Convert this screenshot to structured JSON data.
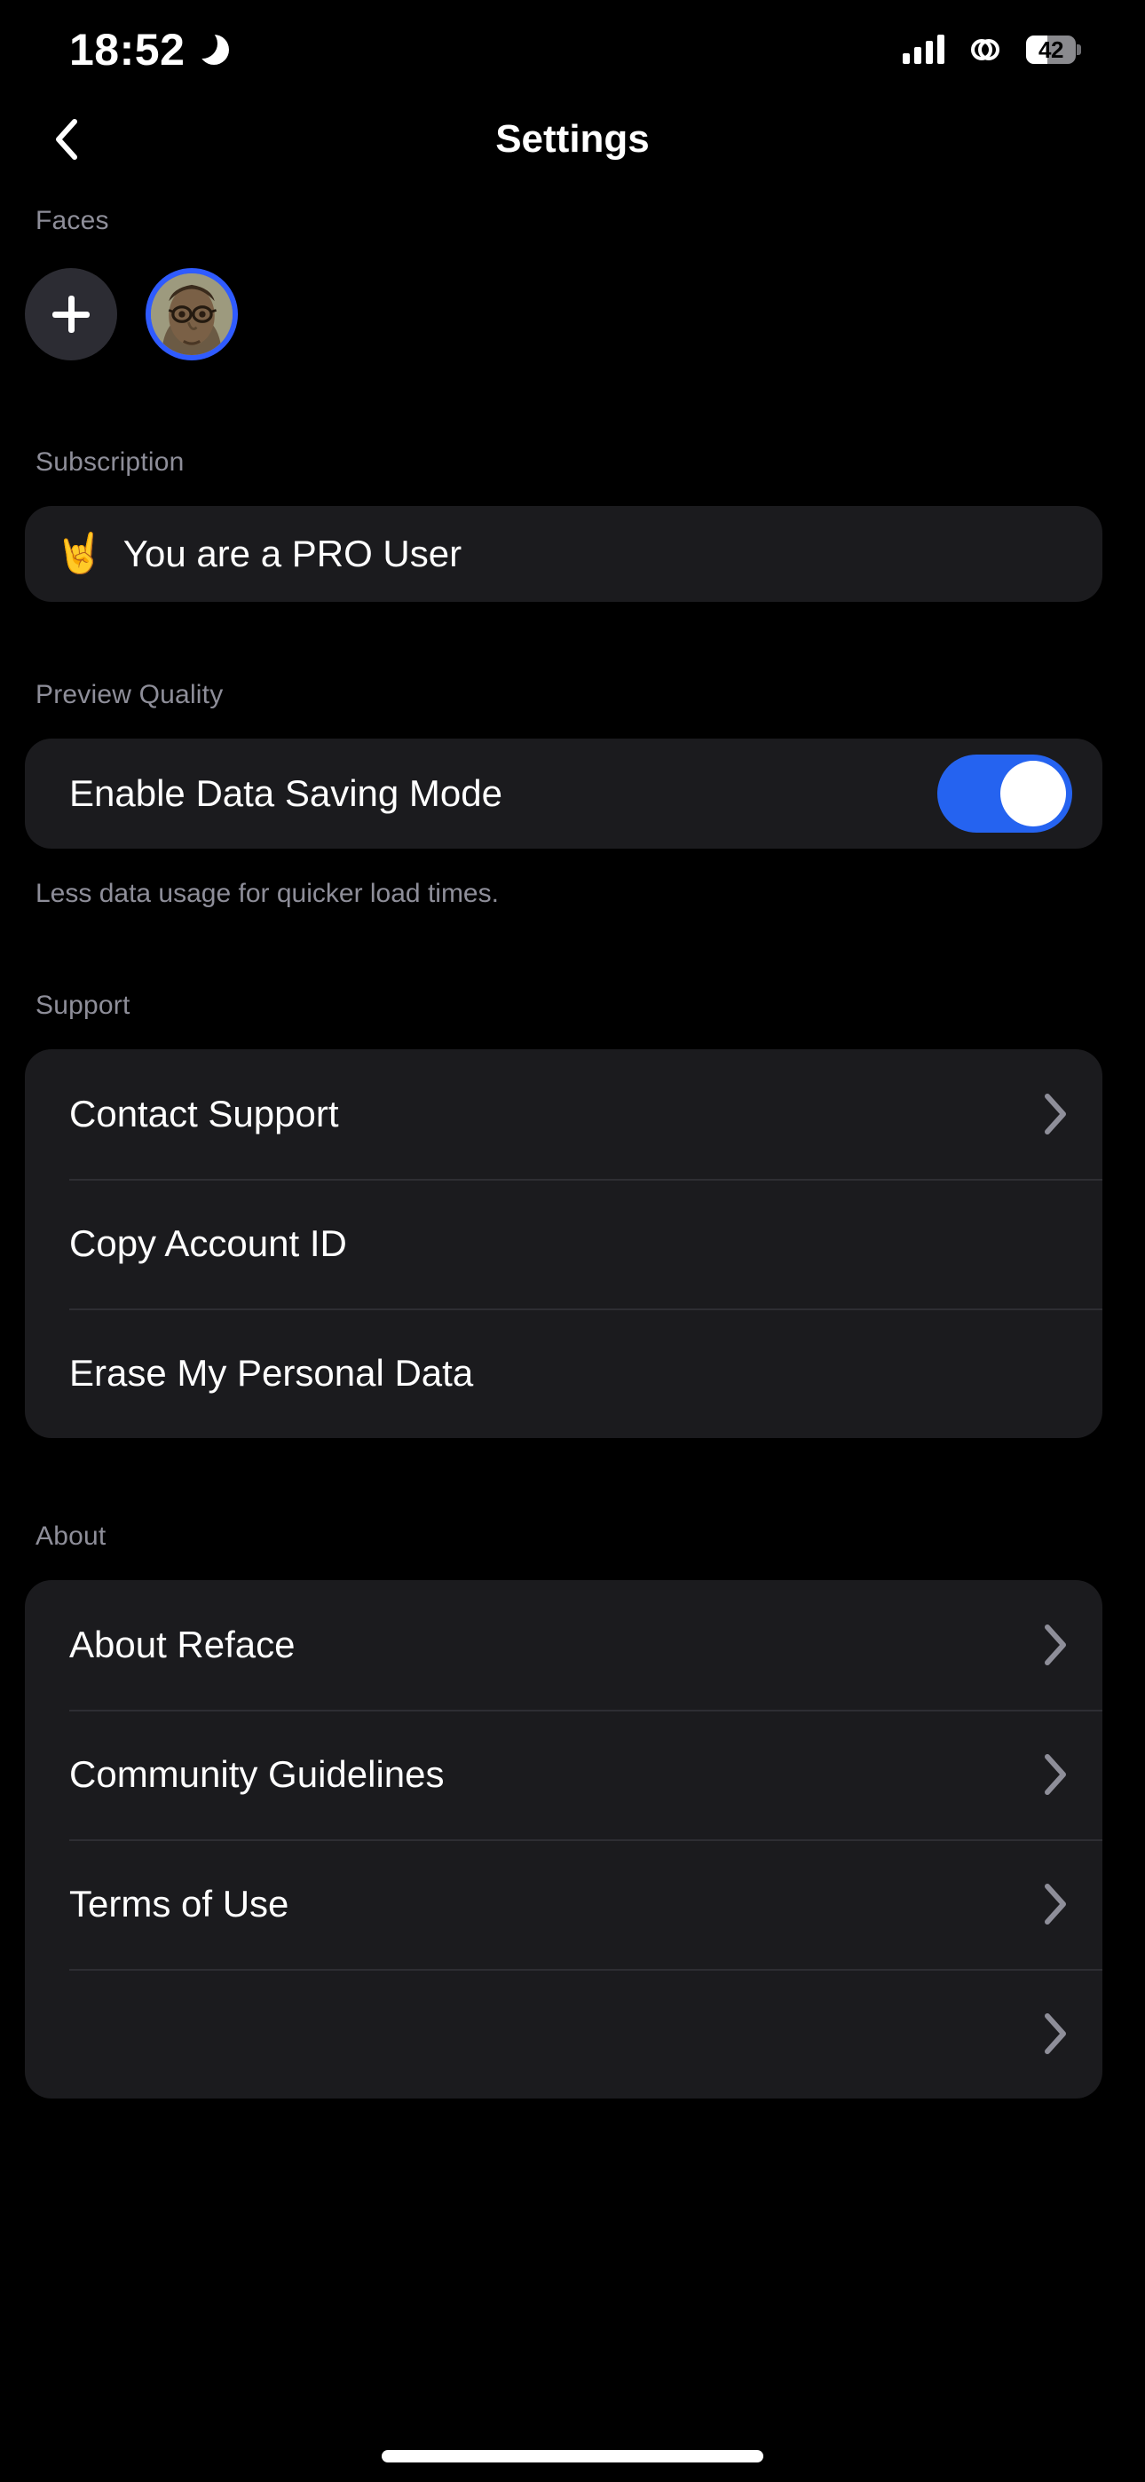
{
  "status_bar": {
    "time": "18:52",
    "dnd_icon": "crescent-moon-icon",
    "signal_icon": "cellular-signal-icon",
    "link_icon": "link-chain-icon",
    "battery_percent": "42",
    "battery_level": 42
  },
  "nav": {
    "back_icon": "chevron-left-icon",
    "title": "Settings"
  },
  "faces": {
    "label": "Faces",
    "add_icon": "plus-icon",
    "avatars": [
      {
        "type": "add",
        "label": "+"
      },
      {
        "type": "photo",
        "selected": true,
        "ring_color": "#2F5BFF"
      }
    ]
  },
  "subscription": {
    "label": "Subscription",
    "emoji": "🤘",
    "text": "You are a PRO User"
  },
  "preview_quality": {
    "label": "Preview Quality",
    "toggle_label": "Enable Data Saving Mode",
    "toggle_on": true,
    "toggle_color": "#2563F0",
    "note": "Less data usage for quicker load times."
  },
  "support": {
    "label": "Support",
    "items": [
      {
        "label": "Contact Support",
        "chevron": true
      },
      {
        "label": "Copy Account ID",
        "chevron": false
      },
      {
        "label": "Erase My Personal Data",
        "chevron": false
      }
    ]
  },
  "about": {
    "label": "About",
    "items": [
      {
        "label": "About Reface",
        "chevron": true
      },
      {
        "label": "Community Guidelines",
        "chevron": true
      },
      {
        "label": "Terms of Use",
        "chevron": true
      }
    ]
  },
  "colors": {
    "background": "#000000",
    "card": "#1B1B1E",
    "section_label": "#8E8E99",
    "accent_blue": "#2563F0",
    "divider": "#2E2E33"
  }
}
